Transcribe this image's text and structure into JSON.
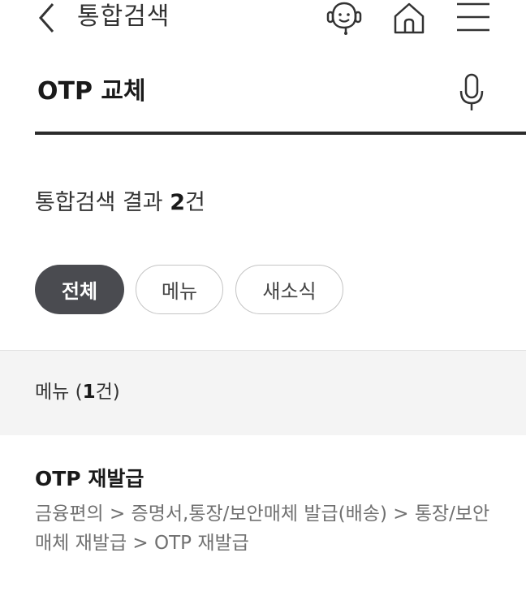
{
  "header": {
    "back_icon": "chevron-left-icon",
    "title": "통합검색",
    "icons": [
      "chatbot-icon",
      "home-icon",
      "hamburger-menu-icon"
    ]
  },
  "search": {
    "query": "OTP 교체",
    "mic_icon": "microphone-icon"
  },
  "summary": {
    "prefix": "통합검색 결과 ",
    "count": "2",
    "suffix": "건"
  },
  "filters": {
    "all": "전체",
    "menu": "메뉴",
    "news": "새소식",
    "active": "전체"
  },
  "section": {
    "label": "메뉴 (",
    "count": "1",
    "suffix": "건)"
  },
  "results": [
    {
      "title": "OTP 재발급",
      "path": "금융편의  >  증명서,통장/보안매체 발급(배송)  >  통장/보안매체 재발급  >  OTP 재발급"
    }
  ],
  "colors": {
    "active_chip": "#4a4b50",
    "divider": "#2b2b2b",
    "section_bg": "#f4f4f4"
  }
}
